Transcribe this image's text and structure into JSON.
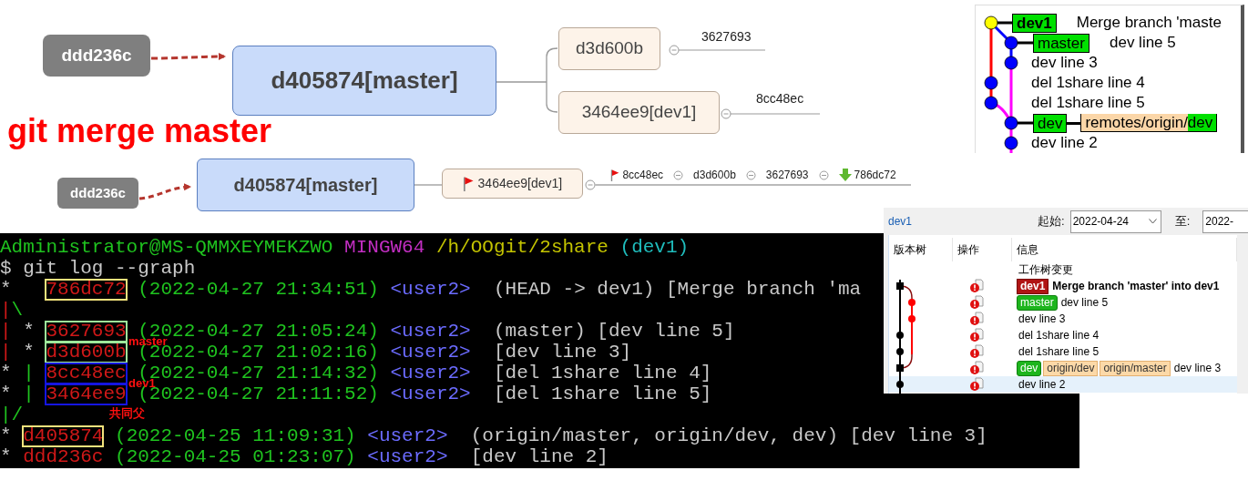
{
  "top_map": {
    "root": "ddd236c",
    "center": "d405874[master]",
    "branches": [
      {
        "label": "d3d600b",
        "child": "3627693"
      },
      {
        "label": "3464ee9[dev1]",
        "child": "8cc48ec"
      }
    ]
  },
  "heading": "git merge master",
  "bottom_map": {
    "root": "ddd236c",
    "center": "d405874[master]",
    "branch": {
      "label": "3464ee9[dev1]",
      "kind": "flag"
    },
    "chain": [
      {
        "label": "8cc48ec",
        "kind": "flag"
      },
      {
        "label": "d3d600b",
        "kind": "plain"
      },
      {
        "label": "3627693",
        "kind": "plain"
      },
      {
        "label": "786dc72",
        "kind": "arrow"
      }
    ]
  },
  "branch_graph": {
    "rows": [
      {
        "kind": "main",
        "head": true,
        "refs": [
          {
            "kind": "local",
            "name": "dev1"
          }
        ],
        "message": "Merge branch 'maste"
      },
      {
        "kind": "side",
        "head": false,
        "refs": [
          {
            "kind": "local",
            "name": "master"
          }
        ],
        "message": "dev line 5"
      },
      {
        "kind": "side",
        "head": false,
        "message": "dev line 3"
      },
      {
        "kind": "main",
        "head": false,
        "message": "del 1share line 4"
      },
      {
        "kind": "main",
        "head": false,
        "message": "del 1share line 5"
      },
      {
        "kind": "side",
        "head": false,
        "refs": [
          {
            "kind": "local",
            "name": "dev"
          },
          {
            "kind": "remote",
            "prefix": "remotes/origin/",
            "name": "dev"
          }
        ]
      },
      {
        "kind": "side",
        "head": false,
        "message": "dev line 2"
      }
    ]
  },
  "terminal": {
    "lines": [
      {
        "segments": [
          {
            "kind": "user",
            "text": "Administrator@MS-QMMXEYMEKZWO"
          },
          {
            "kind": "host",
            "text": " MINGW64"
          },
          {
            "kind": "path",
            "text": " /h/OOgit/2share"
          },
          {
            "kind": "branch",
            "text": " (dev1)"
          }
        ]
      },
      {
        "segments": [
          {
            "kind": "text",
            "text": "$ git log --graph"
          }
        ]
      },
      {
        "segments": [
          {
            "kind": "graph",
            "text": "*   "
          },
          {
            "kind": "hash",
            "text": "786dc72",
            "color": "#f3e27c"
          },
          {
            "kind": "date",
            "text": " (2022-04-27 21:34:51)"
          },
          {
            "kind": "author",
            "text": " <user2>"
          },
          {
            "kind": "text",
            "text": "  (HEAD -> dev1) [Merge branch 'ma"
          }
        ]
      },
      {
        "segments": [
          {
            "kind": "lane-red",
            "text": "|"
          },
          {
            "kind": "lane-green",
            "text": "\\"
          }
        ]
      },
      {
        "segments": [
          {
            "kind": "lane-red",
            "text": "|"
          },
          {
            "kind": "graph",
            "text": " * "
          },
          {
            "kind": "hash",
            "text": "3627693",
            "color": "#9ee89a"
          },
          {
            "kind": "date",
            "text": " (2022-04-27 21:05:24)"
          },
          {
            "kind": "author",
            "text": " <user2>"
          },
          {
            "kind": "text",
            "text": "  (master) [dev line 5]"
          }
        ]
      },
      {
        "segments": [
          {
            "kind": "lane-red",
            "text": "|"
          },
          {
            "kind": "graph",
            "text": " * "
          },
          {
            "kind": "hash",
            "text": "d3d600b",
            "color": "#9ee89a"
          },
          {
            "kind": "date",
            "text": " (2022-04-27 21:02:16)"
          },
          {
            "kind": "author",
            "text": " <user2>"
          },
          {
            "kind": "text",
            "text": "  [dev line 3]"
          }
        ]
      },
      {
        "segments": [
          {
            "kind": "graph",
            "text": "* "
          },
          {
            "kind": "lane-green",
            "text": "| "
          },
          {
            "kind": "hash",
            "text": "8cc48ec",
            "color": "#1515e0"
          },
          {
            "kind": "date",
            "text": " (2022-04-27 21:14:32)"
          },
          {
            "kind": "author",
            "text": " <user2>"
          },
          {
            "kind": "text",
            "text": "  [del 1share line 4]"
          }
        ]
      },
      {
        "segments": [
          {
            "kind": "graph",
            "text": "* "
          },
          {
            "kind": "lane-green",
            "text": "| "
          },
          {
            "kind": "hash",
            "text": "3464ee9",
            "color": "#1515e0"
          },
          {
            "kind": "date",
            "text": " (2022-04-27 21:11:52)"
          },
          {
            "kind": "author",
            "text": " <user2>"
          },
          {
            "kind": "text",
            "text": "  [del 1share line 5]"
          }
        ]
      },
      {
        "segments": [
          {
            "kind": "lane-green",
            "text": "|/"
          }
        ]
      },
      {
        "segments": [
          {
            "kind": "graph",
            "text": "* "
          },
          {
            "kind": "hash",
            "text": "d405874",
            "color": "#f3e27c"
          },
          {
            "kind": "date",
            "text": " (2022-04-25 11:09:31)"
          },
          {
            "kind": "author",
            "text": " <user2>"
          },
          {
            "kind": "text",
            "text": "  (origin/master, origin/dev, dev) [dev line 3]"
          }
        ]
      },
      {
        "segments": [
          {
            "kind": "graph",
            "text": "* "
          },
          {
            "kind": "hash",
            "text": "ddd236c"
          },
          {
            "kind": "date",
            "text": " (2022-04-25 01:23:07)"
          },
          {
            "kind": "author",
            "text": " <user2>"
          },
          {
            "kind": "text",
            "text": "  [dev line 2]"
          }
        ]
      }
    ],
    "notes": [
      {
        "text": "master"
      },
      {
        "text": "dev1"
      },
      {
        "text": "共同父"
      }
    ]
  },
  "log_panel": {
    "branch": "dev1",
    "from_label": "起始:",
    "from_date": "2022-04-24",
    "to_label": "至:",
    "to_date": "2022-",
    "columns": [
      "版本树",
      "操作",
      "信息"
    ],
    "rows": [
      {
        "kind": "worktree",
        "message": "工作树变更",
        "selected": false
      },
      {
        "kind": "commit",
        "refs": [
          {
            "kind": "head",
            "name": "dev1"
          }
        ],
        "message": "Merge branch 'master' into dev1",
        "selected": false
      },
      {
        "kind": "commit",
        "refs": [
          {
            "kind": "local",
            "name": "master"
          }
        ],
        "message": "dev line 5",
        "selected": false
      },
      {
        "kind": "commit",
        "message": "dev line 3",
        "selected": false
      },
      {
        "kind": "commit",
        "message": "del 1share line 4",
        "selected": false
      },
      {
        "kind": "commit",
        "message": "del 1share line 5",
        "selected": false
      },
      {
        "kind": "commit",
        "refs": [
          {
            "kind": "local",
            "name": "dev"
          },
          {
            "kind": "remote",
            "name": "origin/dev"
          },
          {
            "kind": "remote",
            "name": "origin/master"
          }
        ],
        "message": "dev line 3",
        "selected": false
      },
      {
        "kind": "commit",
        "message": "dev line 2",
        "selected": true
      }
    ]
  }
}
